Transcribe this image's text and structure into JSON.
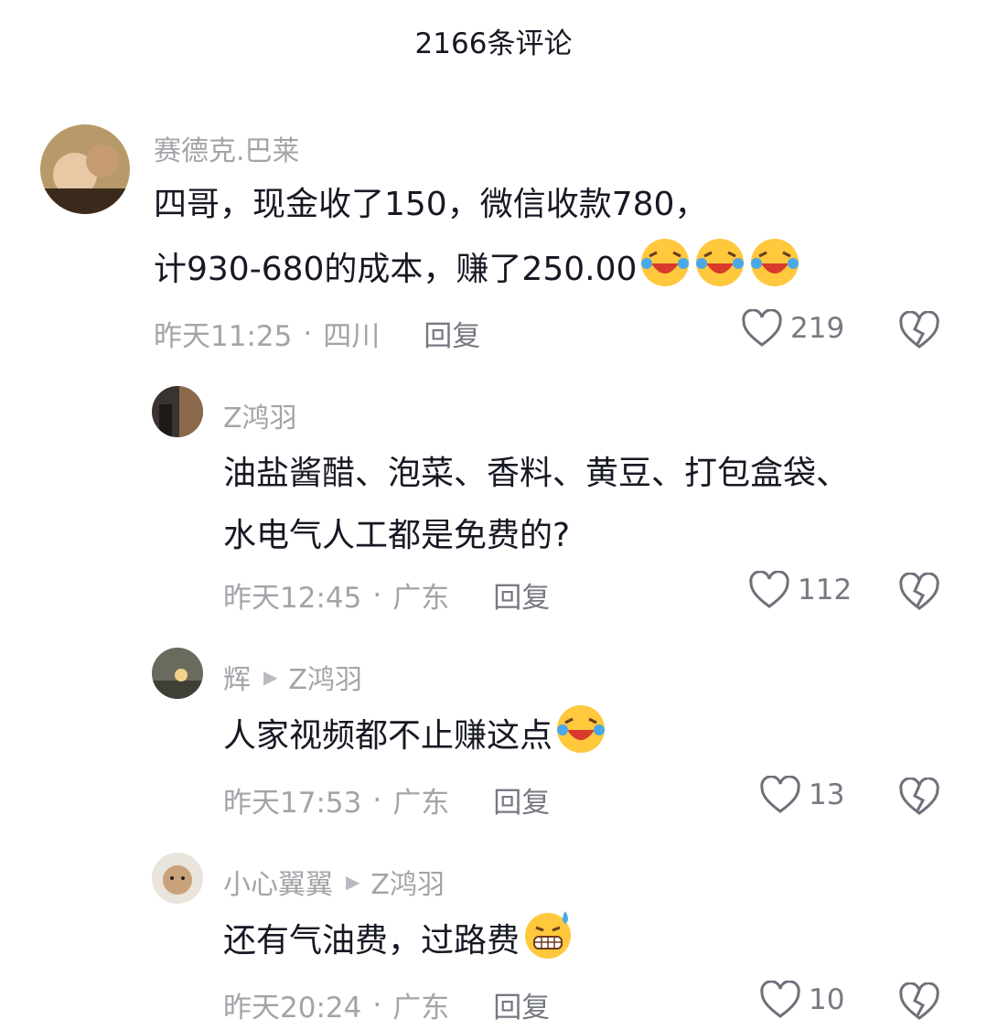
{
  "header": {
    "title": "2166条评论"
  },
  "comments": [
    {
      "author": "赛德克.巴莱",
      "reply_to": "",
      "lines": [
        "四哥，现金收了150，微信收款780，",
        "计930-680的成本，赚了250.00"
      ],
      "emoji": "laughing-crying-emoji",
      "time": "昨天11:25",
      "location": "四川",
      "reply_label": "回复",
      "likes": "219"
    },
    {
      "author": "Z鸿羽",
      "reply_to": "",
      "lines": [
        "油盐酱醋、泡菜、香料、黄豆、打包盒袋、",
        "水电气人工都是免费的?"
      ],
      "emoji": "",
      "time": "昨天12:45",
      "location": "广东",
      "reply_label": "回复",
      "likes": "112"
    },
    {
      "author": "辉",
      "reply_to": "Z鸿羽",
      "lines": [
        "人家视频都不止赚这点"
      ],
      "emoji": "laughing-crying-emoji",
      "time": "昨天17:53",
      "location": "广东",
      "reply_label": "回复",
      "likes": "13"
    },
    {
      "author": "小心翼翼",
      "reply_to": "Z鸿羽",
      "lines": [
        "还有气油费，过路费"
      ],
      "emoji": "sweat-grin-emoji",
      "time": "昨天20:24",
      "location": "广东",
      "reply_label": "回复",
      "likes": "10"
    }
  ],
  "icons": {
    "like": "heart-outline-icon",
    "dislike": "broken-heart-icon",
    "reply_arrow": "triangle-right-icon"
  },
  "colors": {
    "meta": "#a3a4a9",
    "text": "#161823",
    "emoji_face": "#ffc83d"
  }
}
